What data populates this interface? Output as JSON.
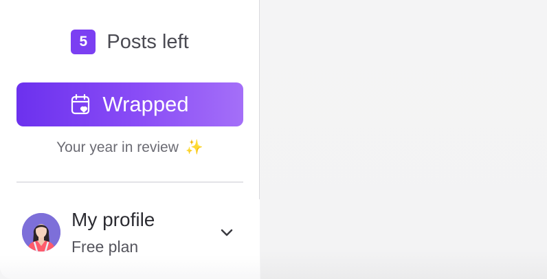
{
  "posts": {
    "count": "5",
    "label": "Posts left"
  },
  "wrapped": {
    "label": "Wrapped",
    "icon": "calendar-heart-icon",
    "tagline": "Your year in review",
    "tagline_emoji": "✨"
  },
  "profile": {
    "name": "My profile",
    "plan": "Free plan",
    "avatar_icon": "user-avatar",
    "menu_icon": "chevron-down-icon"
  },
  "colors": {
    "accent": "#7b3ff2",
    "button_gradient_start": "#6c31ee",
    "button_gradient_end": "#a46ff8"
  }
}
